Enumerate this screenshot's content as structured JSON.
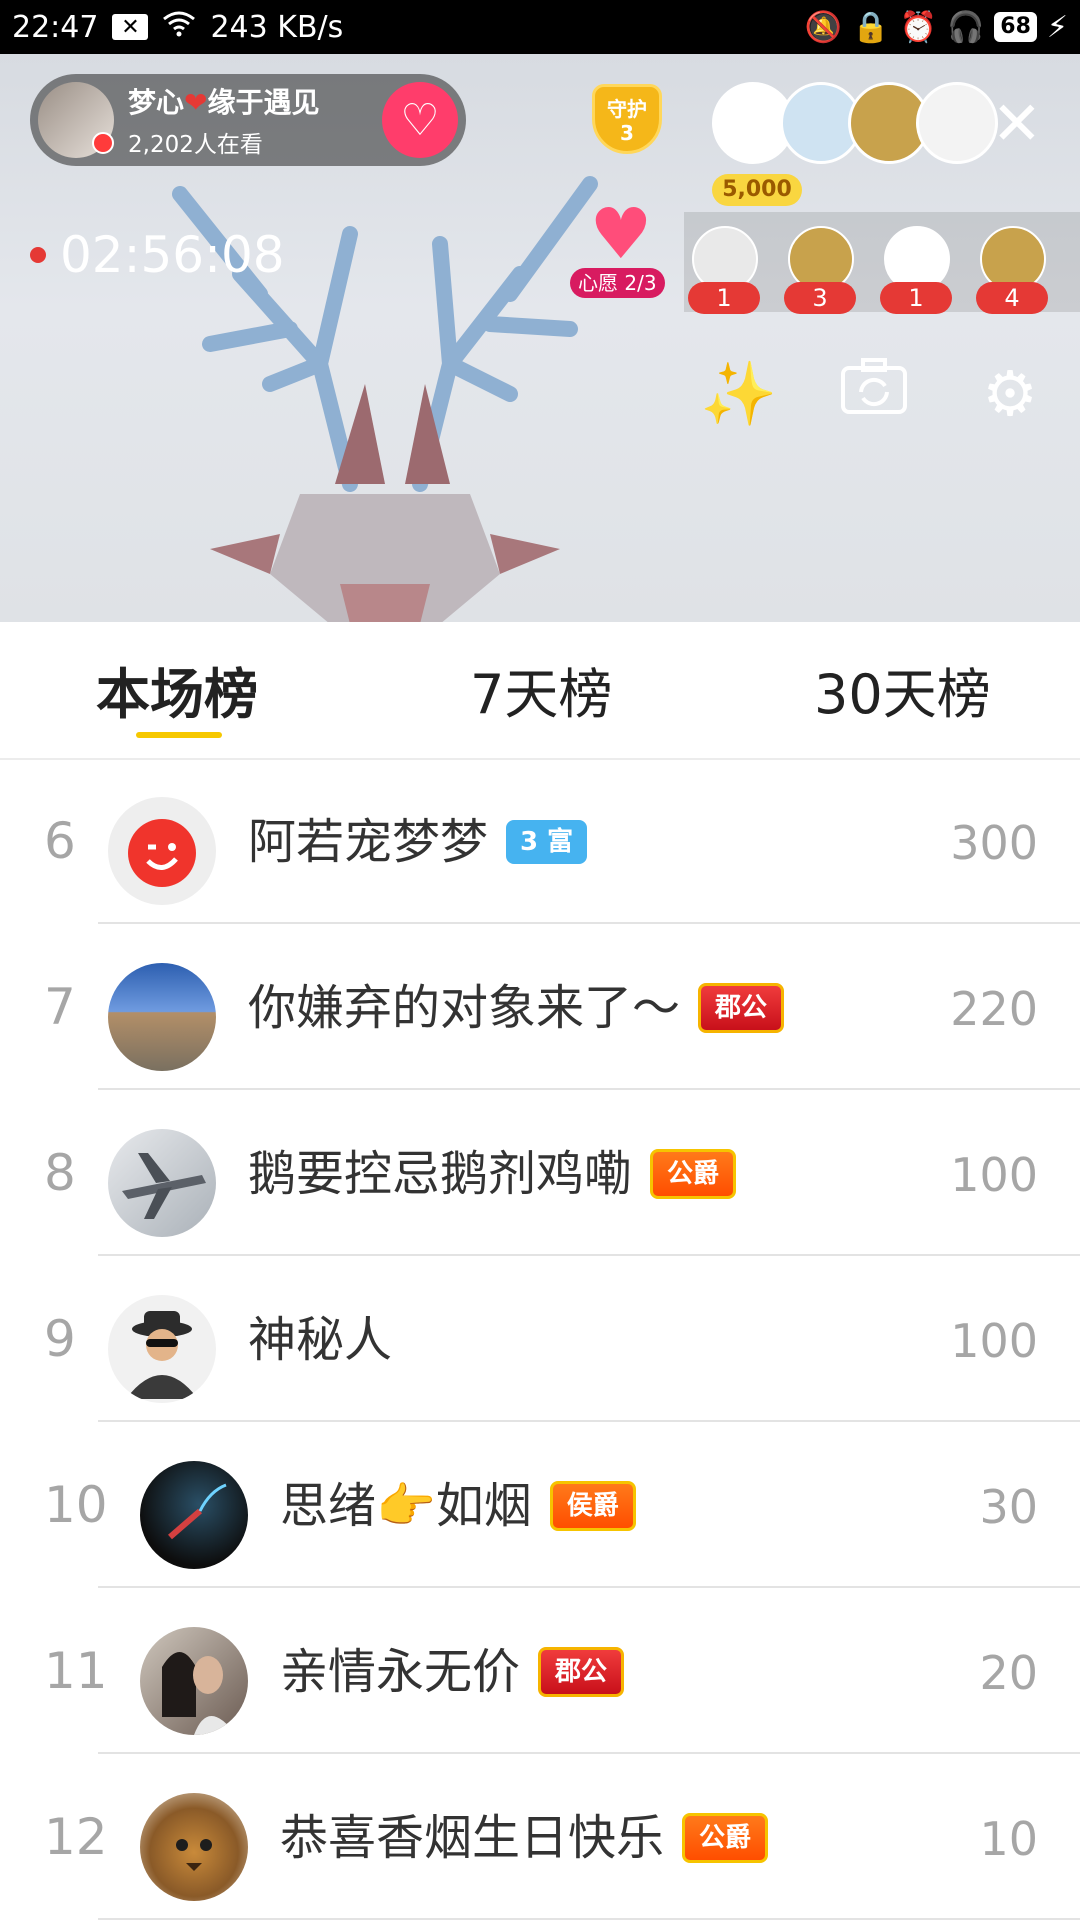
{
  "status_bar": {
    "time": "22:47",
    "net_speed": "243 KB/s",
    "battery": "68"
  },
  "live": {
    "host_name_part1": "梦心",
    "host_name_part2": "缘于遇见",
    "viewers": "2,202人在看",
    "guard_label": "守护",
    "guard_count": "3",
    "top_viewer_count": "5,000",
    "timer": "02:56:08",
    "wish_label": "心愿 2/3",
    "gift_counts": [
      "1",
      "3",
      "1",
      "4"
    ]
  },
  "tabs": [
    "本场榜",
    "7天榜",
    "30天榜"
  ],
  "ranking": [
    {
      "rank": "6",
      "name": "阿若宠梦梦",
      "badge": "3 富",
      "badge_type": "rich",
      "score": "300",
      "avatar": "smiley"
    },
    {
      "rank": "7",
      "name": "你嫌弃的对象来了～",
      "badge": "郡公",
      "badge_type": "noble-red",
      "score": "220",
      "avatar": "road"
    },
    {
      "rank": "8",
      "name": "鹅要控忌鹅剂鸡嘞",
      "badge": "公爵",
      "badge_type": "noble-orange",
      "score": "100",
      "avatar": "jet"
    },
    {
      "rank": "9",
      "name": "神秘人",
      "badge": "",
      "badge_type": "",
      "score": "100",
      "avatar": "mystery"
    },
    {
      "rank": "10",
      "name": "思绪👉如烟",
      "badge": "侯爵",
      "badge_type": "noble-orange",
      "score": "30",
      "avatar": "smoke"
    },
    {
      "rank": "11",
      "name": "亲情永无价",
      "badge": "郡公",
      "badge_type": "noble-red",
      "score": "20",
      "avatar": "couple"
    },
    {
      "rank": "12",
      "name": "恭喜香烟生日快乐",
      "badge": "公爵",
      "badge_type": "noble-orange",
      "score": "10",
      "avatar": "lion"
    }
  ]
}
